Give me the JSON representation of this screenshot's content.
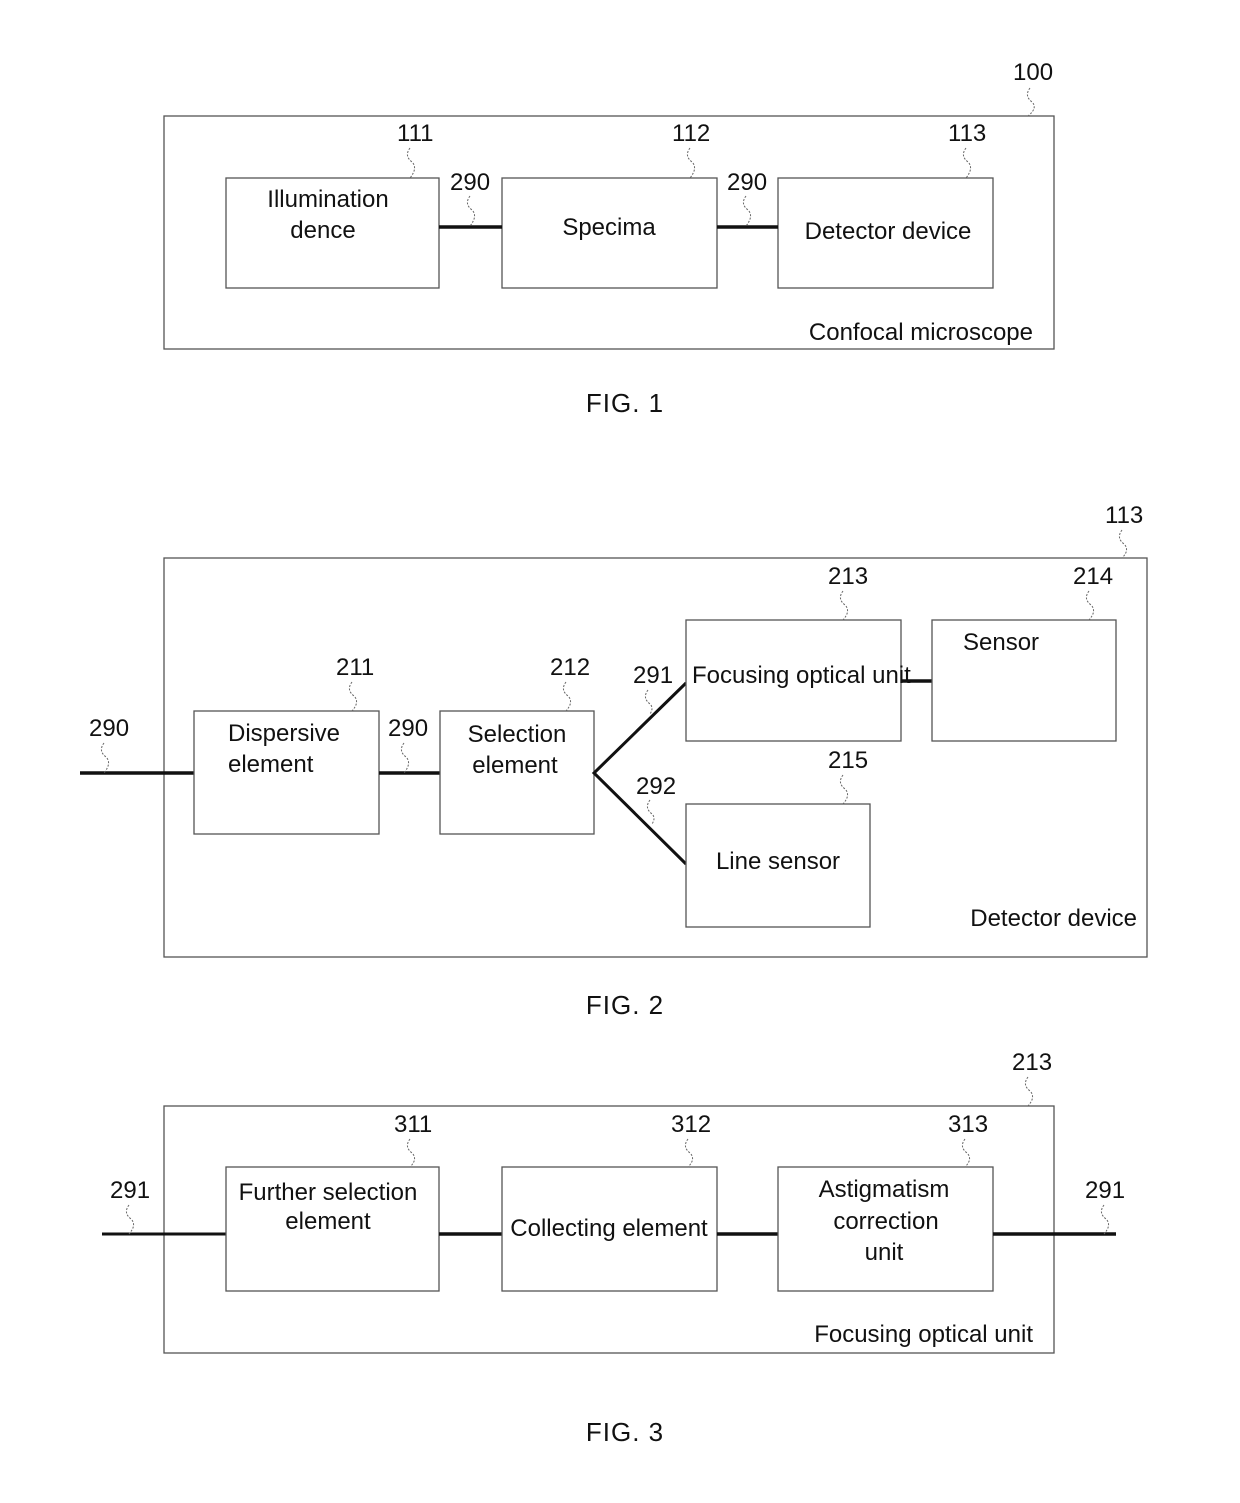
{
  "figures": [
    {
      "caption": "FIG. 1",
      "frame": {
        "ref": "100",
        "label": "Confocal microscope"
      },
      "blocks": [
        {
          "ref": "111",
          "lines": [
            "Illumination",
            "dence"
          ]
        },
        {
          "ref": "112",
          "lines": [
            "Specima"
          ]
        },
        {
          "ref": "113",
          "lines": [
            "Detector device"
          ]
        }
      ],
      "connections": [
        {
          "ref": "290",
          "from": "111",
          "to": "112"
        },
        {
          "ref": "290",
          "from": "112",
          "to": "113"
        }
      ]
    },
    {
      "caption": "FIG. 2",
      "frame": {
        "ref": "113",
        "label": "Detector device"
      },
      "blocks": [
        {
          "ref": "211",
          "lines": [
            "Dispersive",
            "element"
          ]
        },
        {
          "ref": "212",
          "lines": [
            "Selection",
            "element"
          ]
        },
        {
          "ref": "213",
          "lines": [
            "Focusing optical unit"
          ]
        },
        {
          "ref": "214",
          "lines": [
            "Sensor"
          ]
        },
        {
          "ref": "215",
          "lines": [
            "Line sensor"
          ]
        }
      ],
      "connections": [
        {
          "ref": "290",
          "from": "input",
          "to": "211"
        },
        {
          "ref": "290",
          "from": "211",
          "to": "212"
        },
        {
          "ref": "291",
          "from": "212",
          "to": "213"
        },
        {
          "ref": "292",
          "from": "212",
          "to": "215"
        },
        {
          "ref": "",
          "from": "213",
          "to": "214"
        }
      ]
    },
    {
      "caption": "FIG. 3",
      "frame": {
        "ref": "213",
        "label": "Focusing optical unit"
      },
      "blocks": [
        {
          "ref": "311",
          "lines": [
            "Further selection",
            "element"
          ]
        },
        {
          "ref": "312",
          "lines": [
            "Collecting element"
          ]
        },
        {
          "ref": "313",
          "lines": [
            "Astigmatism",
            "correction",
            "unit"
          ]
        }
      ],
      "connections": [
        {
          "ref": "291",
          "from": "input",
          "to": "311"
        },
        {
          "ref": "",
          "from": "311",
          "to": "312"
        },
        {
          "ref": "",
          "from": "312",
          "to": "313"
        },
        {
          "ref": "291",
          "from": "313",
          "to": "output"
        }
      ]
    }
  ]
}
